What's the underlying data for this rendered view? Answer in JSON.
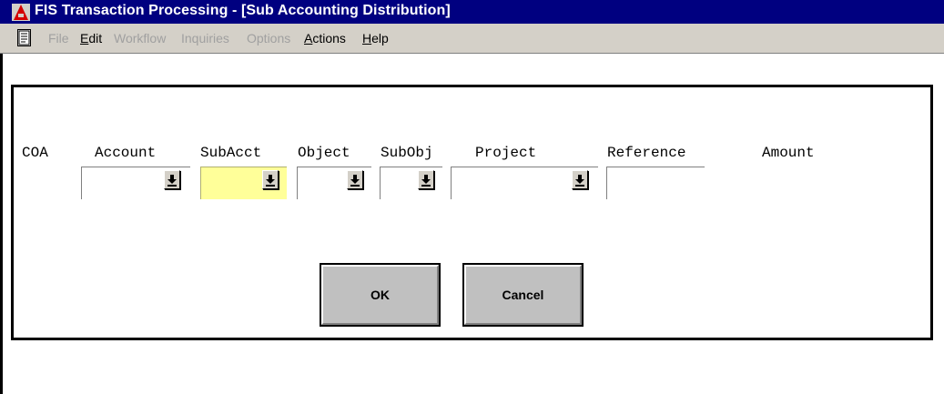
{
  "window": {
    "title": "FIS Transaction Processing - [Sub Accounting Distribution]",
    "app_icon": "fis-a-logo-icon"
  },
  "menubar": {
    "doc_icon": "document-icon",
    "items": [
      {
        "label": "File",
        "enabled": false
      },
      {
        "label": "Edit",
        "enabled": true,
        "accelerator": "E"
      },
      {
        "label": "Workflow",
        "enabled": false
      },
      {
        "label": "Inquiries",
        "enabled": false
      },
      {
        "label": "Options",
        "enabled": false
      },
      {
        "label": "Actions",
        "enabled": true,
        "accelerator": "A"
      },
      {
        "label": "Help",
        "enabled": true,
        "accelerator": "H"
      }
    ]
  },
  "form": {
    "columns": {
      "coa": "COA",
      "account": "Account",
      "subacct": "SubAcct",
      "object": "Object",
      "subobj": "SubObj",
      "project": "Project",
      "reference": "Reference",
      "amount": "Amount"
    },
    "fields": {
      "account": {
        "value": "",
        "focused": false
      },
      "subacct": {
        "value": "",
        "focused": true
      },
      "object": {
        "value": "",
        "focused": false
      },
      "subobj": {
        "value": "",
        "focused": false
      },
      "project": {
        "value": "",
        "focused": false
      },
      "reference": {
        "value": ""
      }
    },
    "dropdown_icon": "dropdown-arrow-icon",
    "highlight_color": "#ffff99"
  },
  "buttons": {
    "ok": "OK",
    "cancel": "Cancel"
  }
}
